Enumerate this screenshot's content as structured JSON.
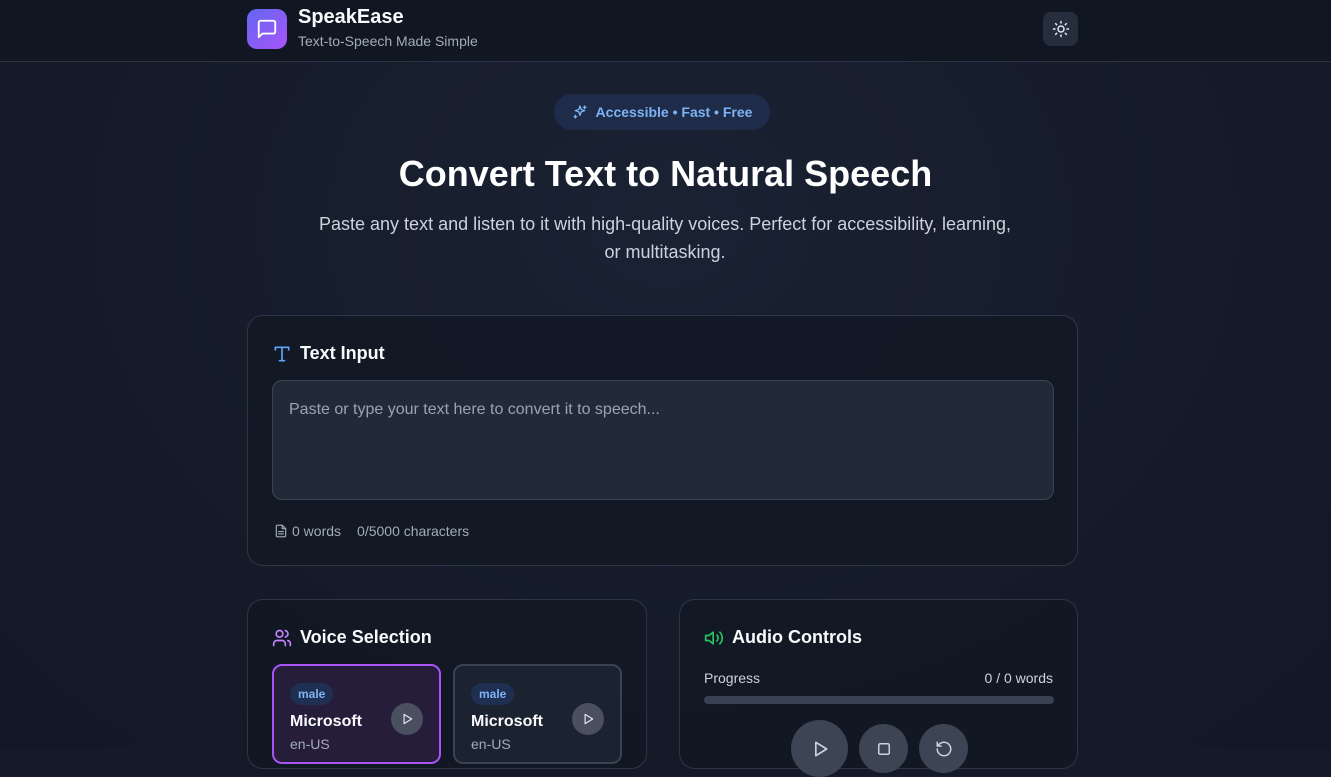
{
  "app": {
    "name": "SpeakEase",
    "tagline": "Text-to-Speech Made Simple"
  },
  "hero": {
    "badge": "Accessible • Fast • Free",
    "title": "Convert Text to Natural Speech",
    "subtitle": "Paste any text and listen to it with high-quality voices. Perfect for accessibility, learning, or multitasking."
  },
  "text_input": {
    "title": "Text Input",
    "placeholder": "Paste or type your text here to convert it to speech...",
    "value": "",
    "word_count": "0 words",
    "char_count": "0/5000 characters"
  },
  "voice_selection": {
    "title": "Voice Selection",
    "voices": [
      {
        "gender": "male",
        "name": "Microsoft",
        "lang": "en-US",
        "selected": true
      },
      {
        "gender": "male",
        "name": "Microsoft",
        "lang": "en-US",
        "selected": false
      }
    ]
  },
  "audio_controls": {
    "title": "Audio Controls",
    "progress_label": "Progress",
    "progress_count": "0 / 0 words",
    "progress_fraction": 0
  },
  "colors": {
    "accent": "#6366f1",
    "accent_purple": "#a855f7",
    "badge_text": "#7db3f5",
    "speaker_icon": "#22c55e"
  },
  "icons": {
    "logo": "message-square-icon",
    "theme_toggle": "sun-icon",
    "badge": "sparkles-icon",
    "text_input": "type-icon",
    "word_count": "file-text-icon",
    "voice_selection": "users-icon",
    "audio_controls": "volume-icon",
    "voice_preview": "play-icon",
    "play": "play-icon",
    "stop": "stop-icon",
    "reset": "rotate-ccw-icon"
  }
}
